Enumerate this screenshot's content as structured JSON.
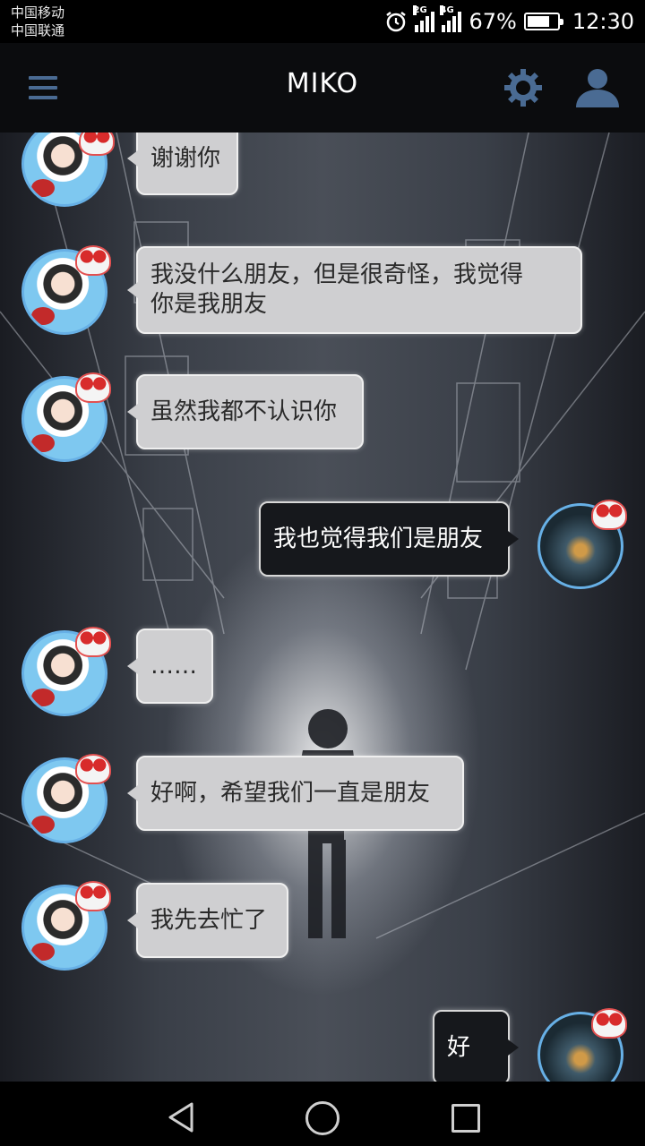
{
  "status_bar": {
    "carrier_1": "中国移动",
    "carrier_2": "中国联通",
    "sim1_network": "2G",
    "sim2_network": "4G",
    "battery_percent": "67%",
    "battery_level": 0.67,
    "time": "12:30",
    "icons": [
      "alarm-icon",
      "signal-icon",
      "signal-icon",
      "battery-icon"
    ]
  },
  "app_bar": {
    "title": "MIKO",
    "accent_color": "#4a6b93",
    "icons": [
      "menu-icon",
      "gear-icon",
      "user-icon"
    ]
  },
  "chat": {
    "messages": [
      {
        "from": "miko",
        "text": "谢谢你"
      },
      {
        "from": "miko",
        "lines": [
          "我没什么朋友，但是很奇怪，我觉得",
          "你是我朋友"
        ]
      },
      {
        "from": "miko",
        "text": "虽然我都不认识你"
      },
      {
        "from": "me",
        "text": "我也觉得我们是朋友"
      },
      {
        "from": "miko",
        "text": "……"
      },
      {
        "from": "miko",
        "text": "好啊，希望我们一直是朋友"
      },
      {
        "from": "miko",
        "text": "我先去忙了"
      },
      {
        "from": "me",
        "text": "好"
      }
    ]
  },
  "nav_bar": {
    "icons": [
      "back-icon",
      "home-icon",
      "recent-apps-icon"
    ]
  }
}
